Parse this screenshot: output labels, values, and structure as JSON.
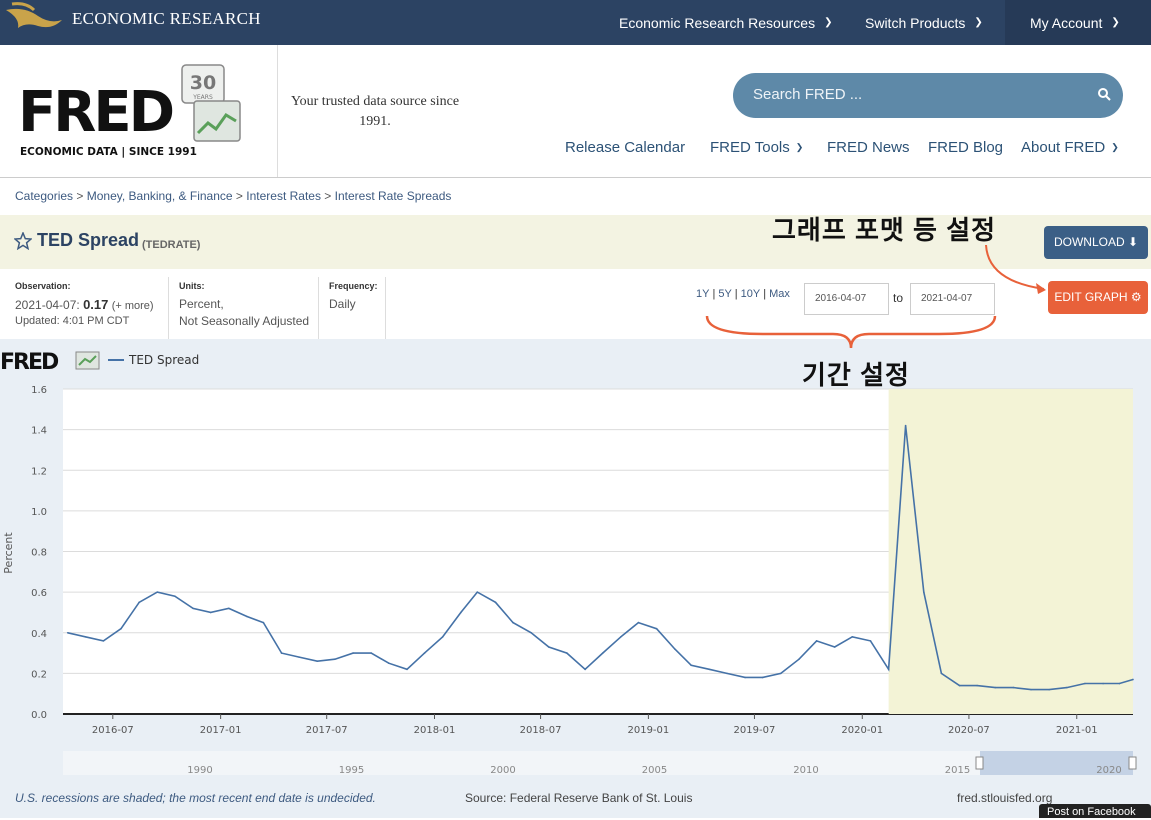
{
  "topbar": {
    "org": "ECONOMIC RESEARCH",
    "nav": [
      "Economic Research Resources",
      "Switch Products",
      "My Account"
    ]
  },
  "header": {
    "logo_text": "FRED",
    "logo_sub": "ECONOMIC DATA  |  SINCE 1991",
    "badge": "30",
    "badge_sub": "YEARS",
    "tagline": "Your trusted data source since 1991.",
    "search_placeholder": "Search FRED ...",
    "nav": [
      "Release Calendar",
      "FRED Tools",
      "FRED News",
      "FRED Blog",
      "About FRED"
    ]
  },
  "breadcrumb": [
    "Categories",
    "Money, Banking, & Finance",
    "Interest Rates",
    "Interest Rate Spreads"
  ],
  "series": {
    "title": "TED Spread",
    "code": "(TEDRATE)",
    "download_label": "DOWNLOAD",
    "edit_label": "EDIT GRAPH"
  },
  "annotations": {
    "graph_format": "그래프 포맷 등 설정",
    "period": "기간 설정"
  },
  "meta": {
    "observation_label": "Observation:",
    "observation_date": "2021-04-07:",
    "observation_value": "0.17",
    "more": "(+ more)",
    "updated": "Updated: 4:01 PM CDT",
    "units_label": "Units:",
    "units_value": "Percent,",
    "units_value2": "Not Seasonally Adjusted",
    "frequency_label": "Frequency:",
    "frequency_value": "Daily"
  },
  "ranges": [
    "1Y",
    "5Y",
    "10Y",
    "Max"
  ],
  "date_from": "2016-04-07",
  "date_to": "2021-04-07",
  "to_label": "to",
  "colors": {
    "series": "#4572a7",
    "recession": "#f3f3d6",
    "accent": "#e8613a",
    "navy": "#2c4363"
  },
  "chart_data": {
    "type": "line",
    "legend": "TED Spread",
    "ylabel": "Percent",
    "ylim": [
      0.0,
      1.6
    ],
    "yticks": [
      "0.0",
      "0.2",
      "0.4",
      "0.6",
      "0.8",
      "1.0",
      "1.2",
      "1.4",
      "1.6"
    ],
    "xticks": [
      "2016-07",
      "2017-01",
      "2017-07",
      "2018-01",
      "2018-07",
      "2019-01",
      "2019-07",
      "2020-01",
      "2020-07",
      "2021-01"
    ],
    "xlim": [
      "2016-04-07",
      "2021-04-07"
    ],
    "recession": [
      "2020-02",
      "2021-04"
    ],
    "x": [
      "2016-04",
      "2016-05",
      "2016-06",
      "2016-07",
      "2016-08",
      "2016-09",
      "2016-10",
      "2016-11",
      "2016-12",
      "2017-01",
      "2017-02",
      "2017-03",
      "2017-04",
      "2017-05",
      "2017-06",
      "2017-07",
      "2017-08",
      "2017-09",
      "2017-10",
      "2017-11",
      "2017-12",
      "2018-01",
      "2018-02",
      "2018-03",
      "2018-04",
      "2018-05",
      "2018-06",
      "2018-07",
      "2018-08",
      "2018-09",
      "2018-10",
      "2018-11",
      "2018-12",
      "2019-01",
      "2019-02",
      "2019-03",
      "2019-04",
      "2019-05",
      "2019-06",
      "2019-07",
      "2019-08",
      "2019-09",
      "2019-10",
      "2019-11",
      "2019-12",
      "2020-01",
      "2020-02",
      "2020-03",
      "2020-04",
      "2020-05",
      "2020-06",
      "2020-07",
      "2020-08",
      "2020-09",
      "2020-10",
      "2020-11",
      "2020-12",
      "2021-01",
      "2021-02",
      "2021-03",
      "2021-04"
    ],
    "values": [
      0.4,
      0.38,
      0.36,
      0.42,
      0.55,
      0.6,
      0.58,
      0.52,
      0.5,
      0.52,
      0.48,
      0.45,
      0.3,
      0.28,
      0.26,
      0.27,
      0.3,
      0.3,
      0.25,
      0.22,
      0.3,
      0.38,
      0.5,
      0.6,
      0.55,
      0.45,
      0.4,
      0.33,
      0.3,
      0.22,
      0.3,
      0.38,
      0.45,
      0.42,
      0.32,
      0.24,
      0.22,
      0.2,
      0.18,
      0.18,
      0.2,
      0.27,
      0.36,
      0.33,
      0.38,
      0.36,
      0.22,
      1.42,
      0.6,
      0.2,
      0.14,
      0.14,
      0.13,
      0.13,
      0.12,
      0.12,
      0.13,
      0.15,
      0.15,
      0.15,
      0.17
    ]
  },
  "navigator_labels": [
    "1990",
    "1995",
    "2000",
    "2005",
    "2010",
    "2015",
    "2020"
  ],
  "footer": {
    "note": "U.S. recessions are shaded; the most recent end date is undecided.",
    "source": "Source: Federal Reserve Bank of St. Louis",
    "url": "fred.stlouisfed.org",
    "facebook": "Post on Facebook"
  }
}
